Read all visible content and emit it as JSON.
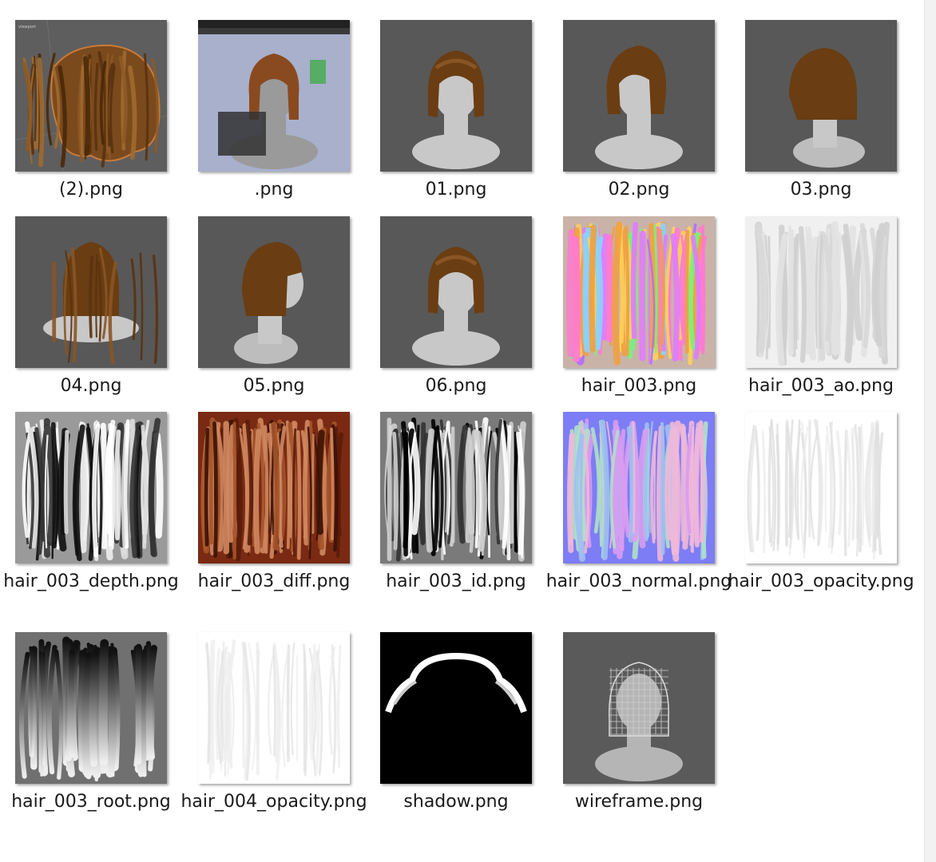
{
  "files": [
    {
      "name": "(2).png",
      "thumb": "hair-viewport",
      "bg": "#5e5e5e"
    },
    {
      "name": ".png",
      "thumb": "app-screenshot",
      "bg": "#a8b0cc"
    },
    {
      "name": "01.png",
      "thumb": "render-front",
      "bg": "#585858"
    },
    {
      "name": "02.png",
      "thumb": "render-three-quarter",
      "bg": "#585858"
    },
    {
      "name": "03.png",
      "thumb": "render-side",
      "bg": "#585858"
    },
    {
      "name": "04.png",
      "thumb": "render-back",
      "bg": "#585858"
    },
    {
      "name": "05.png",
      "thumb": "render-right-side",
      "bg": "#585858"
    },
    {
      "name": "06.png",
      "thumb": "render-front-down",
      "bg": "#585858"
    },
    {
      "name": "hair_003.png",
      "thumb": "color-strands",
      "bg": "#c9b3a8"
    },
    {
      "name": "hair_003_ao.png",
      "thumb": "ao-map",
      "bg": "#f0f0f0"
    },
    {
      "name": "hair_003_depth.png",
      "thumb": "depth-map",
      "bg": "#9a9a9a"
    },
    {
      "name": "hair_003_diff.png",
      "thumb": "diffuse-map",
      "bg": "#7a2a12"
    },
    {
      "name": "hair_003_id.png",
      "thumb": "id-map",
      "bg": "#7a7a7a"
    },
    {
      "name": "hair_003_normal.png",
      "thumb": "normal-map",
      "bg": "#7d7df5"
    },
    {
      "name": "hair_003_opacity.png",
      "thumb": "opacity-map",
      "bg": "#ffffff"
    },
    {
      "name": "hair_003_root.png",
      "thumb": "root-map",
      "bg": "#2a2a2a"
    },
    {
      "name": "hair_004_opacity.png",
      "thumb": "opacity-map-2",
      "bg": "#ffffff"
    },
    {
      "name": "shadow.png",
      "thumb": "shadow-mask",
      "bg": "#000000"
    },
    {
      "name": "wireframe.png",
      "thumb": "wireframe-render",
      "bg": "#5a5a5a"
    }
  ]
}
